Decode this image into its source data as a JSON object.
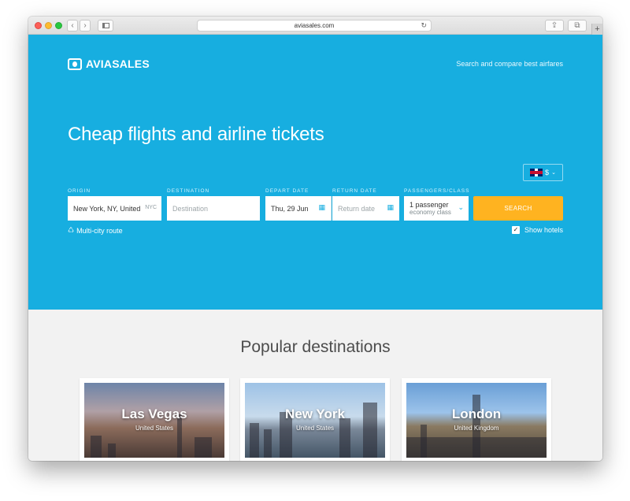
{
  "browser": {
    "url": "aviasales.com",
    "new_tab": "+"
  },
  "header": {
    "logo_text": "AVIASALES",
    "tagline": "Search and compare best airfares"
  },
  "hero": {
    "headline": "Cheap flights and airline tickets"
  },
  "currency": {
    "symbol": "$",
    "language_flag": "uk-flag-icon"
  },
  "search_form": {
    "origin": {
      "label": "ORIGIN",
      "value": "New York, NY, United",
      "iata": "NYC"
    },
    "destination": {
      "label": "DESTINATION",
      "placeholder": "Destination"
    },
    "depart_date": {
      "label": "DEPART DATE",
      "value": "Thu, 29 Jun"
    },
    "return_date": {
      "label": "RETURN DATE",
      "placeholder": "Return date"
    },
    "passengers": {
      "label": "PASSENGERS/CLASS",
      "count": "1 passenger",
      "class": "economy class"
    },
    "search_button": "SEARCH",
    "multi_city": "Multi-city route",
    "show_hotels": "Show hotels",
    "show_hotels_checked": true
  },
  "popular": {
    "title": "Popular destinations",
    "cards": [
      {
        "city": "Las Vegas",
        "country": "United States"
      },
      {
        "city": "New York",
        "country": "United States"
      },
      {
        "city": "London",
        "country": "United Kingdom"
      }
    ]
  },
  "colors": {
    "brand_blue": "#17aee0",
    "search_orange": "#ffb320"
  }
}
